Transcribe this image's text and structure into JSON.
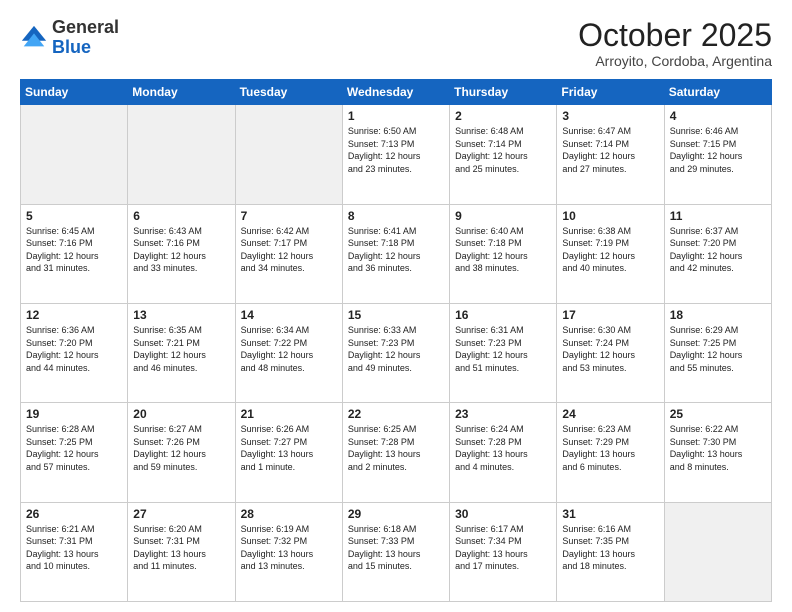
{
  "header": {
    "logo_general": "General",
    "logo_blue": "Blue",
    "month_title": "October 2025",
    "location": "Arroyito, Cordoba, Argentina"
  },
  "weekdays": [
    "Sunday",
    "Monday",
    "Tuesday",
    "Wednesday",
    "Thursday",
    "Friday",
    "Saturday"
  ],
  "weeks": [
    [
      {
        "num": "",
        "info": ""
      },
      {
        "num": "",
        "info": ""
      },
      {
        "num": "",
        "info": ""
      },
      {
        "num": "1",
        "info": "Sunrise: 6:50 AM\nSunset: 7:13 PM\nDaylight: 12 hours\nand 23 minutes."
      },
      {
        "num": "2",
        "info": "Sunrise: 6:48 AM\nSunset: 7:14 PM\nDaylight: 12 hours\nand 25 minutes."
      },
      {
        "num": "3",
        "info": "Sunrise: 6:47 AM\nSunset: 7:14 PM\nDaylight: 12 hours\nand 27 minutes."
      },
      {
        "num": "4",
        "info": "Sunrise: 6:46 AM\nSunset: 7:15 PM\nDaylight: 12 hours\nand 29 minutes."
      }
    ],
    [
      {
        "num": "5",
        "info": "Sunrise: 6:45 AM\nSunset: 7:16 PM\nDaylight: 12 hours\nand 31 minutes."
      },
      {
        "num": "6",
        "info": "Sunrise: 6:43 AM\nSunset: 7:16 PM\nDaylight: 12 hours\nand 33 minutes."
      },
      {
        "num": "7",
        "info": "Sunrise: 6:42 AM\nSunset: 7:17 PM\nDaylight: 12 hours\nand 34 minutes."
      },
      {
        "num": "8",
        "info": "Sunrise: 6:41 AM\nSunset: 7:18 PM\nDaylight: 12 hours\nand 36 minutes."
      },
      {
        "num": "9",
        "info": "Sunrise: 6:40 AM\nSunset: 7:18 PM\nDaylight: 12 hours\nand 38 minutes."
      },
      {
        "num": "10",
        "info": "Sunrise: 6:38 AM\nSunset: 7:19 PM\nDaylight: 12 hours\nand 40 minutes."
      },
      {
        "num": "11",
        "info": "Sunrise: 6:37 AM\nSunset: 7:20 PM\nDaylight: 12 hours\nand 42 minutes."
      }
    ],
    [
      {
        "num": "12",
        "info": "Sunrise: 6:36 AM\nSunset: 7:20 PM\nDaylight: 12 hours\nand 44 minutes."
      },
      {
        "num": "13",
        "info": "Sunrise: 6:35 AM\nSunset: 7:21 PM\nDaylight: 12 hours\nand 46 minutes."
      },
      {
        "num": "14",
        "info": "Sunrise: 6:34 AM\nSunset: 7:22 PM\nDaylight: 12 hours\nand 48 minutes."
      },
      {
        "num": "15",
        "info": "Sunrise: 6:33 AM\nSunset: 7:23 PM\nDaylight: 12 hours\nand 49 minutes."
      },
      {
        "num": "16",
        "info": "Sunrise: 6:31 AM\nSunset: 7:23 PM\nDaylight: 12 hours\nand 51 minutes."
      },
      {
        "num": "17",
        "info": "Sunrise: 6:30 AM\nSunset: 7:24 PM\nDaylight: 12 hours\nand 53 minutes."
      },
      {
        "num": "18",
        "info": "Sunrise: 6:29 AM\nSunset: 7:25 PM\nDaylight: 12 hours\nand 55 minutes."
      }
    ],
    [
      {
        "num": "19",
        "info": "Sunrise: 6:28 AM\nSunset: 7:25 PM\nDaylight: 12 hours\nand 57 minutes."
      },
      {
        "num": "20",
        "info": "Sunrise: 6:27 AM\nSunset: 7:26 PM\nDaylight: 12 hours\nand 59 minutes."
      },
      {
        "num": "21",
        "info": "Sunrise: 6:26 AM\nSunset: 7:27 PM\nDaylight: 13 hours\nand 1 minute."
      },
      {
        "num": "22",
        "info": "Sunrise: 6:25 AM\nSunset: 7:28 PM\nDaylight: 13 hours\nand 2 minutes."
      },
      {
        "num": "23",
        "info": "Sunrise: 6:24 AM\nSunset: 7:28 PM\nDaylight: 13 hours\nand 4 minutes."
      },
      {
        "num": "24",
        "info": "Sunrise: 6:23 AM\nSunset: 7:29 PM\nDaylight: 13 hours\nand 6 minutes."
      },
      {
        "num": "25",
        "info": "Sunrise: 6:22 AM\nSunset: 7:30 PM\nDaylight: 13 hours\nand 8 minutes."
      }
    ],
    [
      {
        "num": "26",
        "info": "Sunrise: 6:21 AM\nSunset: 7:31 PM\nDaylight: 13 hours\nand 10 minutes."
      },
      {
        "num": "27",
        "info": "Sunrise: 6:20 AM\nSunset: 7:31 PM\nDaylight: 13 hours\nand 11 minutes."
      },
      {
        "num": "28",
        "info": "Sunrise: 6:19 AM\nSunset: 7:32 PM\nDaylight: 13 hours\nand 13 minutes."
      },
      {
        "num": "29",
        "info": "Sunrise: 6:18 AM\nSunset: 7:33 PM\nDaylight: 13 hours\nand 15 minutes."
      },
      {
        "num": "30",
        "info": "Sunrise: 6:17 AM\nSunset: 7:34 PM\nDaylight: 13 hours\nand 17 minutes."
      },
      {
        "num": "31",
        "info": "Sunrise: 6:16 AM\nSunset: 7:35 PM\nDaylight: 13 hours\nand 18 minutes."
      },
      {
        "num": "",
        "info": ""
      }
    ]
  ]
}
